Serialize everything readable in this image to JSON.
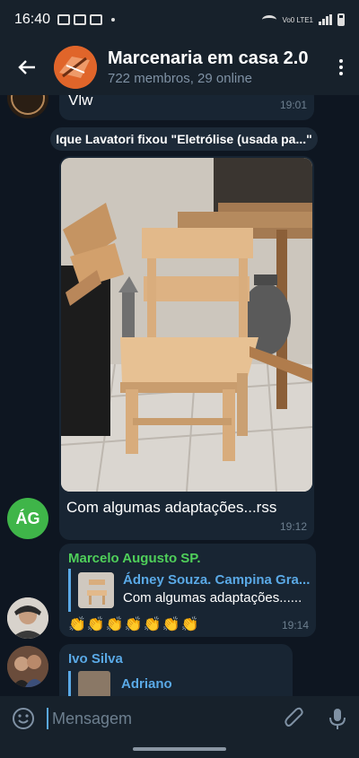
{
  "status_bar": {
    "time": "16:40",
    "network_label": "Vo0 LTE1"
  },
  "header": {
    "title": "Marcenaria em casa 2.0",
    "subtitle": "722 membros, 29 online"
  },
  "messages": {
    "top": {
      "text": "Vlw",
      "time": "19:01"
    },
    "service": {
      "text": "Ique Lavatori fixou \"Eletrólise (usada pa...\""
    },
    "photo": {
      "caption": "Com algumas adaptações...rss",
      "time": "19:12",
      "avatar_initials": "ÁG"
    },
    "reply": {
      "sender": "Marcelo Augusto SP.",
      "sender_color": "#4fcf5a",
      "quote_name": "Ádney Souza. Campina Gra...",
      "quote_text": "Com algumas adaptações......",
      "emojis": "👏👏👏👏👏👏👏",
      "time": "19:14"
    },
    "ivo": {
      "sender": "Ivo Silva",
      "sender_color": "#5aa9e6",
      "quote_name": "Adriano"
    }
  },
  "input": {
    "placeholder": "Mensagem"
  },
  "colors": {
    "accent": "#5aa9e6",
    "bubble": "#182533",
    "background": "#0e1621",
    "bar": "#17212b"
  }
}
